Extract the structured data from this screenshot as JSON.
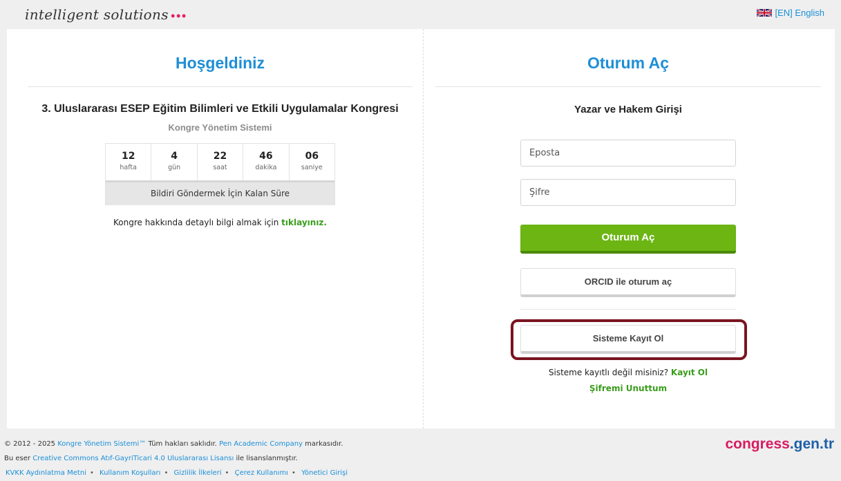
{
  "brand": {
    "text": "intelligent solutions",
    "dots": "•••"
  },
  "language": {
    "label": "[EN] English"
  },
  "welcome": {
    "title": "Hoşgeldiniz",
    "congress_name": "3. Uluslararası ESEP Eğitim Bilimleri ve Etkili Uygulamalar Kongresi",
    "system_name": "Kongre Yönetim Sistemi",
    "countdown": [
      {
        "value": "12",
        "unit": "hafta"
      },
      {
        "value": "4",
        "unit": "gün"
      },
      {
        "value": "22",
        "unit": "saat"
      },
      {
        "value": "46",
        "unit": "dakika"
      },
      {
        "value": "06",
        "unit": "saniye"
      }
    ],
    "countdown_label": "Bildiri Göndermek İçin Kalan Süre",
    "info_text": "Kongre hakkında detaylı bilgi almak için",
    "info_link": "tıklayınız."
  },
  "login": {
    "title": "Oturum Aç",
    "subtitle": "Yazar ve Hakem Girişi",
    "email_placeholder": "Eposta",
    "password_placeholder": "Şifre",
    "login_button": "Oturum Aç",
    "orcid_button": "ORCID ile oturum aç",
    "register_button": "Sisteme Kayıt Ol",
    "not_registered_text": "Sisteme kayıtlı değil misiniz?",
    "register_link": "Kayıt Ol",
    "forgot_password": "Şifremi Unuttum"
  },
  "footer": {
    "copyright_prefix": "© 2012 - 2025",
    "product_link": "Kongre Yönetim Sistemi™",
    "rights_text": "Tüm hakları saklıdır.",
    "company_link": "Pen Academic Company",
    "brand_suffix": "markasıdır.",
    "license_prefix": "Bu eser",
    "license_link": "Creative Commons Atıf-GayriTicari 4.0 Uluslararası Lisansı",
    "license_suffix": "ile lisanslanmıştır.",
    "links": [
      "KVKK Aydınlatma Metni",
      "Kullanım Koşulları",
      "Gizlilik İlkeleri",
      "Çerez Kullanımı",
      "Yönetici Girişi"
    ],
    "logo_part1": "congress",
    "logo_part2": ".gen.tr"
  },
  "colors": {
    "title_blue": "#1e8ed6",
    "login_green": "#6cb513",
    "link_green": "#3a9d1c",
    "highlight_ring": "#7a1420",
    "logo_pink": "#d81b60",
    "logo_blue": "#1e5fa8"
  }
}
